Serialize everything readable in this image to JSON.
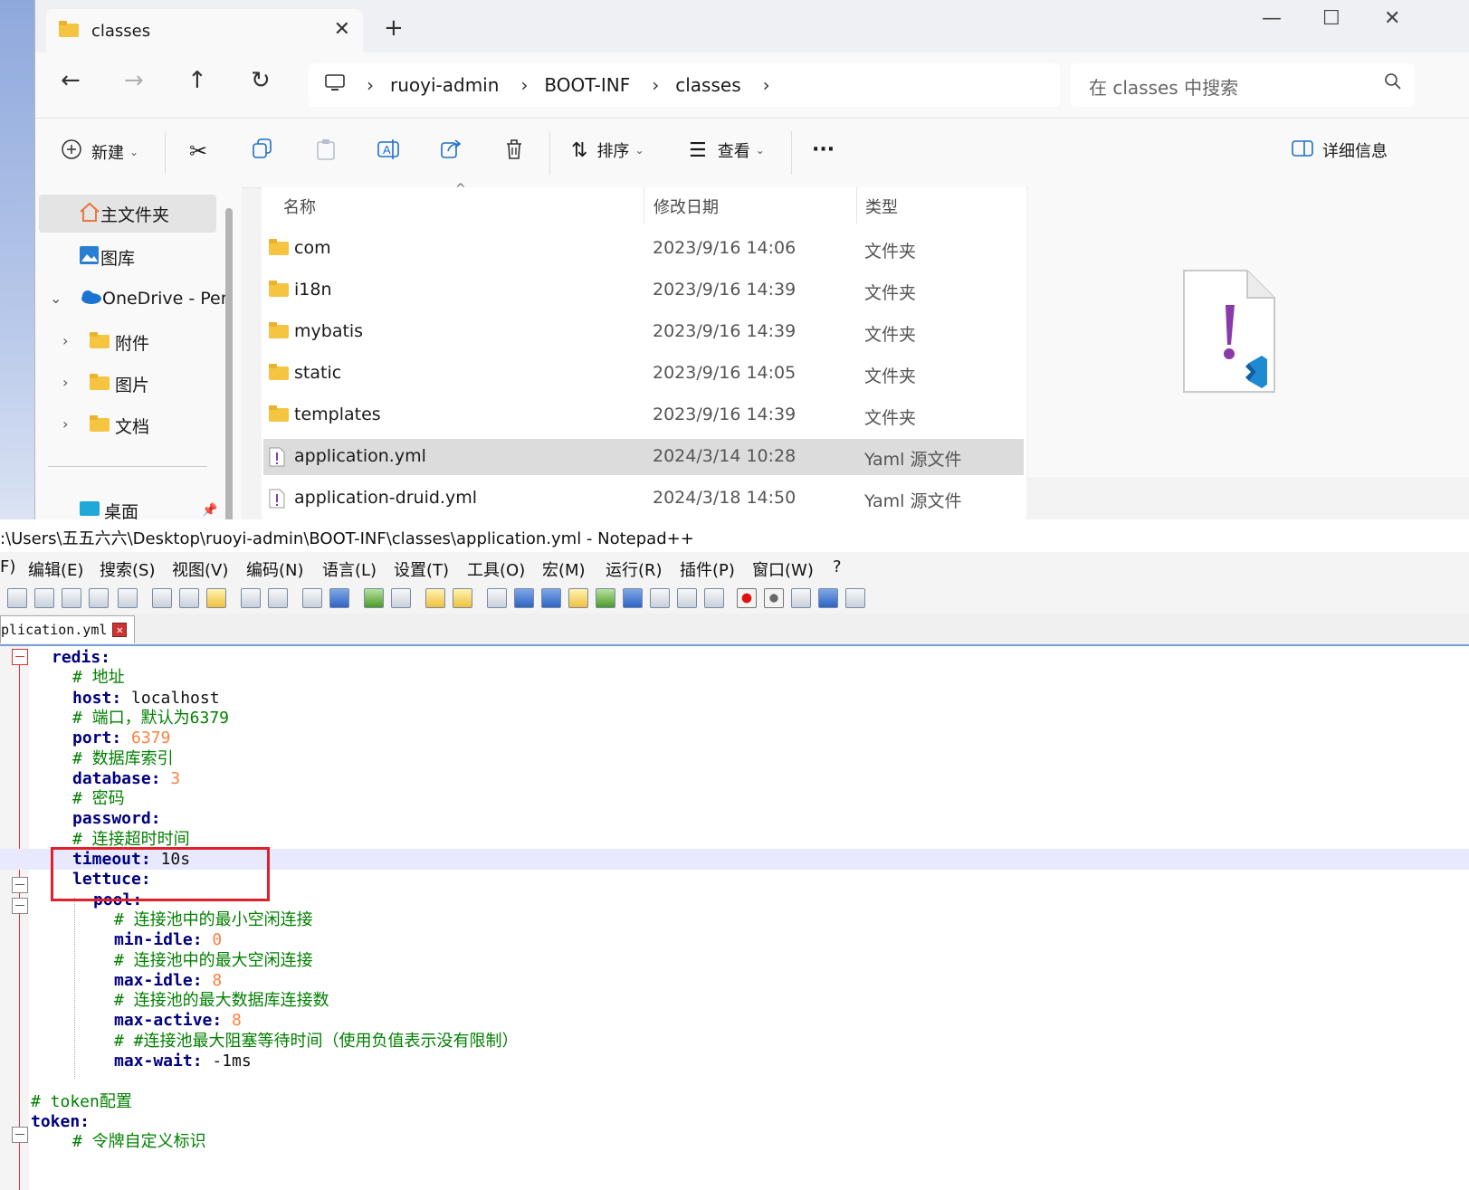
{
  "explorer": {
    "tab_title": "classes",
    "breadcrumb": [
      "ruoyi-admin",
      "BOOT-INF",
      "classes"
    ],
    "search_placeholder": "在 classes 中搜索",
    "commands": {
      "new": "新建",
      "sort": "排序",
      "view": "查看",
      "more": "···",
      "details": "详细信息"
    },
    "sidebar": {
      "home": "主文件夹",
      "gallery": "图库",
      "onedrive": "OneDrive - Per",
      "folders": [
        "附件",
        "图片",
        "文档"
      ],
      "desktop": "桌面"
    },
    "columns": {
      "name": "名称",
      "date": "修改日期",
      "type": "类型"
    },
    "files": [
      {
        "name": "com",
        "date": "2023/9/16 14:06",
        "type": "文件夹",
        "kind": "folder"
      },
      {
        "name": "i18n",
        "date": "2023/9/16 14:39",
        "type": "文件夹",
        "kind": "folder"
      },
      {
        "name": "mybatis",
        "date": "2023/9/16 14:39",
        "type": "文件夹",
        "kind": "folder"
      },
      {
        "name": "static",
        "date": "2023/9/16 14:05",
        "type": "文件夹",
        "kind": "folder"
      },
      {
        "name": "templates",
        "date": "2023/9/16 14:39",
        "type": "文件夹",
        "kind": "folder"
      },
      {
        "name": "application.yml",
        "date": "2024/3/14 10:28",
        "type": "Yaml 源文件",
        "kind": "yaml",
        "selected": true
      },
      {
        "name": "application-druid.yml",
        "date": "2024/3/18 14:50",
        "type": "Yaml 源文件",
        "kind": "yaml"
      }
    ]
  },
  "npp": {
    "title": ":\\Users\\五五六六\\Desktop\\ruoyi-admin\\BOOT-INF\\classes\\application.yml - Notepad++",
    "menus": [
      "F)",
      "编辑(E)",
      "搜索(S)",
      "视图(V)",
      "编码(N)",
      "语言(L)",
      "设置(T)",
      "工具(O)",
      "宏(M)",
      "运行(R)",
      "插件(P)",
      "窗口(W)",
      "?"
    ],
    "tab_name": "plication.yml",
    "lines": [
      {
        "key": "redis:",
        "indent": 2
      },
      {
        "comment": "# 地址",
        "indent": 4
      },
      {
        "key": "host:",
        "value": " localhost",
        "indent": 4
      },
      {
        "comment": "# 端口，默认为6379",
        "indent": 4
      },
      {
        "key": "port:",
        "num": " 6379",
        "indent": 4
      },
      {
        "comment": "# 数据库索引",
        "indent": 4
      },
      {
        "key": "database:",
        "num": " 3",
        "indent": 4
      },
      {
        "comment": "# 密码",
        "indent": 4
      },
      {
        "key": "password:",
        "indent": 4
      },
      {
        "comment": "# 连接超时时间",
        "indent": 4
      },
      {
        "key": "timeout:",
        "value": " 10s",
        "indent": 4,
        "current": true
      },
      {
        "key": "lettuce:",
        "indent": 4
      },
      {
        "key": "pool:",
        "indent": 6
      },
      {
        "comment": "# 连接池中的最小空闲连接",
        "indent": 8
      },
      {
        "key": "min-idle:",
        "num": " 0",
        "indent": 8
      },
      {
        "comment": "# 连接池中的最大空闲连接",
        "indent": 8
      },
      {
        "key": "max-idle:",
        "num": " 8",
        "indent": 8
      },
      {
        "comment": "# 连接池的最大数据库连接数",
        "indent": 8
      },
      {
        "key": "max-active:",
        "num": " 8",
        "indent": 8
      },
      {
        "comment": "# #连接池最大阻塞等待时间（使用负值表示没有限制）",
        "indent": 8
      },
      {
        "key": "max-wait:",
        "value": " -1ms",
        "indent": 8
      },
      {
        "blank": true
      },
      {
        "comment": "# token配置",
        "indent": 0
      },
      {
        "key": "token:",
        "indent": 0
      },
      {
        "comment": "# 令牌自定义标识",
        "indent": 4
      }
    ]
  }
}
